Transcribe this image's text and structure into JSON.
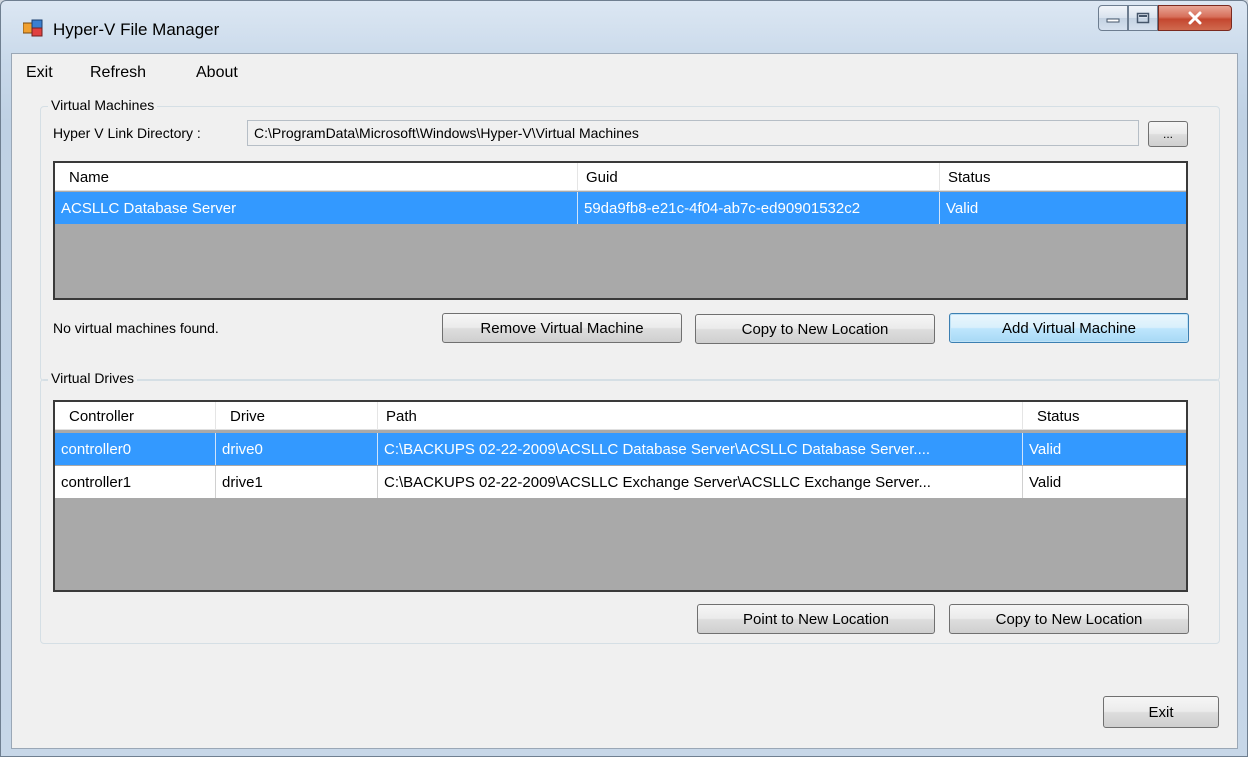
{
  "window": {
    "title": "Hyper-V File Manager"
  },
  "menu": [
    "Exit",
    "Refresh",
    "About"
  ],
  "virtual_machines": {
    "group_label": "Virtual Machines",
    "link_label": "Hyper V Link Directory :",
    "link_path": "C:\\ProgramData\\Microsoft\\Windows\\Hyper-V\\Virtual Machines",
    "browse_label": "...",
    "columns": [
      "Name",
      "Guid",
      "Status"
    ],
    "rows": [
      {
        "name": "ACSLLC Database Server",
        "guid": "59da9fb8-e21c-4f04-ab7c-ed90901532c2",
        "status": "Valid"
      }
    ],
    "status_text": "No virtual machines found.",
    "remove_label": "Remove Virtual Machine",
    "copy_label": "Copy to New Location",
    "add_label": "Add Virtual Machine"
  },
  "virtual_drives": {
    "group_label": "Virtual Drives",
    "columns": [
      "Controller",
      "Drive",
      "Path",
      "Status"
    ],
    "rows": [
      {
        "controller": "controller0",
        "drive": "drive0",
        "path": "C:\\BACKUPS 02-22-2009\\ACSLLC Database Server\\ACSLLC Database Server....",
        "status": "Valid"
      },
      {
        "controller": "controller1",
        "drive": "drive1",
        "path": "C:\\BACKUPS 02-22-2009\\ACSLLC Exchange Server\\ACSLLC Exchange Server...",
        "status": "Valid"
      }
    ],
    "point_label": "Point to New Location",
    "copy_label": "Copy to New Location"
  },
  "exit_label": "Exit",
  "colors": {
    "selection": "#3399ff",
    "list_background": "#a9a9a9",
    "control_face": "#f0f0f0",
    "close_button": "#c4472f"
  }
}
